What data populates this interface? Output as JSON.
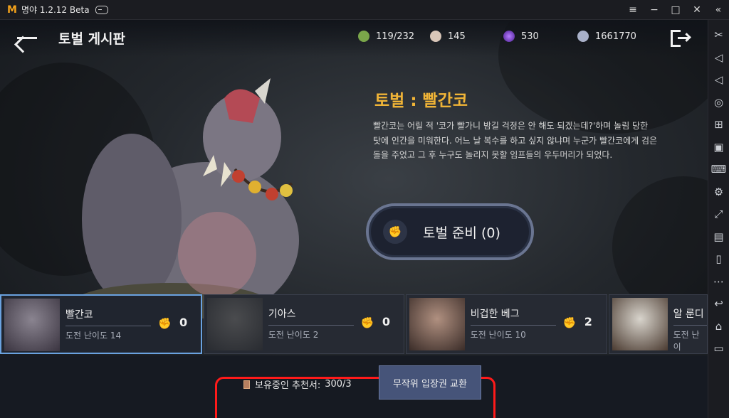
{
  "app": {
    "title": "명야 1.2.12 Beta",
    "logo": "M"
  },
  "window_controls": {
    "menu_icon": "≡",
    "minimize": "−",
    "maximize": "□",
    "close": "✕",
    "expand": "«"
  },
  "side_tools": [
    "scissors-icon",
    "volume-up-icon",
    "volume-down-icon",
    "location-icon",
    "add-window-icon",
    "apk-install-icon",
    "keyboard-icon",
    "settings-icon",
    "fullscreen-icon",
    "screen-record-icon",
    "shake-icon",
    "more-icon",
    "back-icon",
    "home-icon",
    "recent-apps-icon"
  ],
  "header": {
    "title": "토벌 게시판"
  },
  "resources": [
    {
      "name": "stamina",
      "value": "119/232",
      "color": "#7aa64a"
    },
    {
      "name": "pearl",
      "value": "145",
      "color": "#d8c6b8"
    },
    {
      "name": "gem",
      "value": "530",
      "color": "#7a3cd0"
    },
    {
      "name": "silver",
      "value": "1661770",
      "color": "#a9b1c9"
    }
  ],
  "boss": {
    "title": "토벌 : 빨간코",
    "description": "빨간코는 어릴 적 '코가 빨가니 밤길 걱정은 안 해도 되겠는데?'하며 놀림 당한 탓에 인간을 미워한다. 어느 날 복수를 하고 싶지 않냐며 누군가 빨간코에게 검은 돌을 주었고 그 후 누구도 놀리지 못할 임프들의 우두머리가 되었다."
  },
  "ready_button": {
    "label": "토벌 준비 (0)"
  },
  "cards": [
    {
      "name": "빨간코",
      "difficulty": "도전 난이도 14",
      "count": "0",
      "selected": true
    },
    {
      "name": "기아스",
      "difficulty": "도전 난이도 2",
      "count": "0",
      "selected": false
    },
    {
      "name": "비겁한 베그",
      "difficulty": "도전 난이도 10",
      "count": "2",
      "selected": false
    },
    {
      "name": "알 룬디",
      "difficulty": "도전 난이",
      "count": "",
      "selected": false
    }
  ],
  "bottom": {
    "holding_label": "보유중인 추천서:",
    "holding_value": "300/3",
    "exchange_button": "무작위 입장권 교환"
  }
}
